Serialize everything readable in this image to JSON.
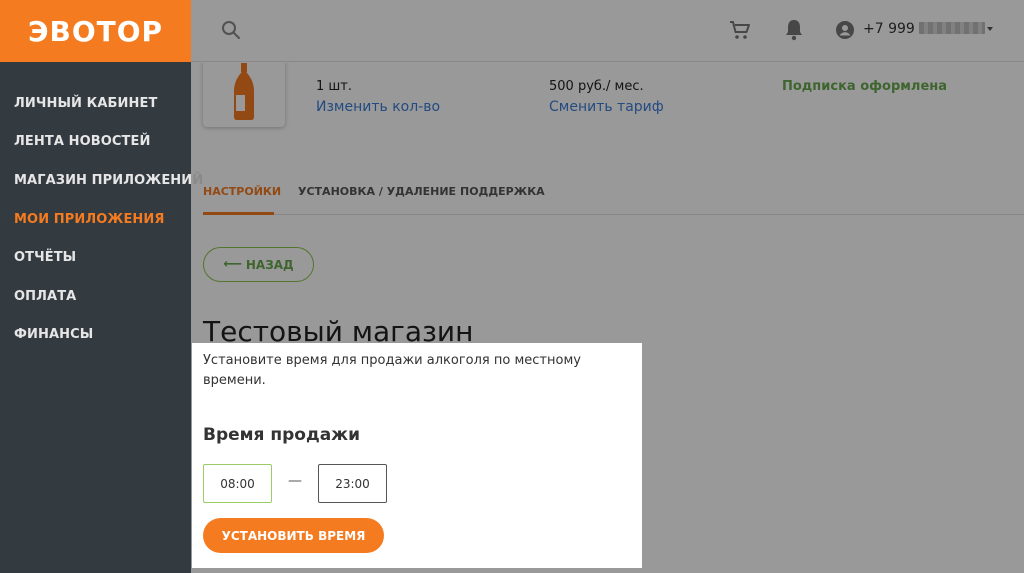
{
  "app": {
    "logo": "ЭВОТОР"
  },
  "sidebar": {
    "items": [
      {
        "label": "ЛИЧНЫЙ КАБИНЕТ",
        "active": false
      },
      {
        "label": "ЛЕНТА НОВОСТЕЙ",
        "active": false
      },
      {
        "label": "МАГАЗИН ПРИЛОЖЕНИЙ",
        "active": false
      },
      {
        "label": "МОИ ПРИЛОЖЕНИЯ",
        "active": true
      },
      {
        "label": "ОТЧЁТЫ",
        "active": false
      },
      {
        "label": "ОПЛАТА",
        "active": false
      },
      {
        "label": "ФИНАНСЫ",
        "active": false
      }
    ]
  },
  "header": {
    "phone": "+7 999",
    "icons": [
      "search-icon",
      "cart-icon",
      "bell-icon",
      "user-icon",
      "caret-down-icon"
    ]
  },
  "app_info": {
    "quantity": "1 шт.",
    "quantity_link": "Изменить кол-во",
    "price": "500 руб./ мес.",
    "price_link": "Сменить тариф",
    "status": "Подписка оформлена"
  },
  "tabs": [
    {
      "label": "НАСТРОЙКИ",
      "active": true
    },
    {
      "label": "УСТАНОВКА / УДАЛЕНИЕ",
      "active": false
    },
    {
      "label": "ПОДДЕРЖКА",
      "active": false
    }
  ],
  "back_button": {
    "arrow": "⟵",
    "label": "НАЗАД"
  },
  "store": {
    "title": "Тестовый магазин"
  },
  "alcohol_panel": {
    "description": "Установите время для продажи алкоголя по местному времени.",
    "title": "Время продажи",
    "from": "08:00",
    "separator": "—",
    "to": "23:00",
    "button": "УСТАНОВИТЬ ВРЕМЯ"
  },
  "colors": {
    "brand": "#f47b20",
    "sidebar": "#333a40",
    "link": "#3b7dd8",
    "success": "#6aa84f"
  }
}
